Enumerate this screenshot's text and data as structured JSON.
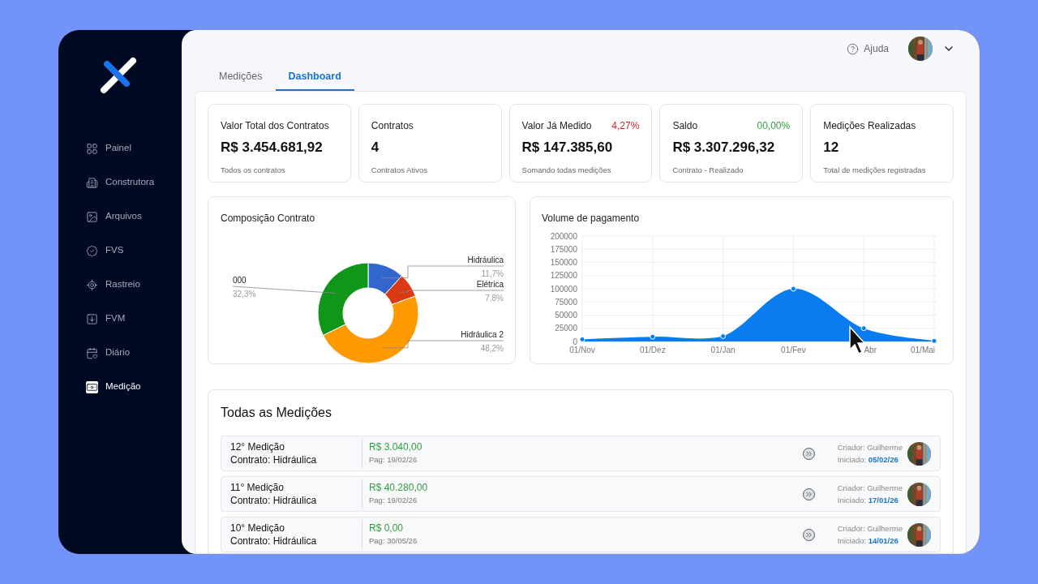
{
  "sidebar": {
    "items": [
      {
        "label": "Painel",
        "selected": false
      },
      {
        "label": "Construtora",
        "selected": false
      },
      {
        "label": "Arquivos",
        "selected": false
      },
      {
        "label": "FVS",
        "selected": false
      },
      {
        "label": "Rastreio",
        "selected": false
      },
      {
        "label": "FVM",
        "selected": false
      },
      {
        "label": "Diário",
        "selected": false
      },
      {
        "label": "Medição",
        "selected": true
      }
    ]
  },
  "header": {
    "help": "Ajuda"
  },
  "tabs": [
    {
      "label": "Medições",
      "selected": false
    },
    {
      "label": "Dashboard",
      "selected": true
    }
  ],
  "stats": [
    {
      "title": "Valor Total dos Contratos",
      "value": "R$ 3.454.681,92",
      "caption": "Todos os contratos"
    },
    {
      "title": "Contratos",
      "value": "4",
      "caption": "Contratos Ativos"
    },
    {
      "title": "Valor Já Medido",
      "badge": "4,27%",
      "color": "#c62828",
      "value": "R$ 147.385,60",
      "caption": "Somando todas medições"
    },
    {
      "title": "Saldo",
      "badge": "00,00%",
      "color": "#2e9e3e",
      "value": "R$ 3.307.296,32",
      "caption": "Contrato - Realizado"
    },
    {
      "title": "Medições Realizadas",
      "value": "12",
      "caption": "Total de medições registradas"
    }
  ],
  "composition": {
    "title": "Composição Contrato",
    "chart_data": {
      "type": "donut",
      "categories": [
        "Hidráulica",
        "Elétrica",
        "Hidráulica 2",
        "000"
      ],
      "values": [
        11.7,
        7.8,
        48.2,
        32.3
      ],
      "colors": [
        "#3366cc",
        "#dc3912",
        "#ff9900",
        "#109618"
      ],
      "value_labels": [
        "11,7%",
        "7,8%",
        "48,2%",
        "32,3%"
      ]
    }
  },
  "payments": {
    "title": "Volume de pagamento",
    "chart_data": {
      "type": "area",
      "categories": [
        "01/Nov",
        "01/Dez",
        "01/Jan",
        "01/Fev",
        "Abr",
        "01/Mai"
      ],
      "grid": true,
      "series": [
        {
          "color": "#0a7cf0",
          "values": [
            4000,
            9000,
            10000,
            100000,
            25000,
            1000
          ]
        }
      ],
      "ylim": [
        0,
        200000
      ],
      "yticks": [
        0,
        25000,
        50000,
        75000,
        100000,
        125000,
        150000,
        175000,
        200000
      ]
    }
  },
  "measurements": {
    "title": "Todas as Medições",
    "rows": [
      {
        "name": "12° Medição",
        "contract": "Contrato: Hidráulica",
        "amount": "R$ 3.040,00",
        "paid": "Pag: 19/02/26",
        "creator": "Criador: Guilherme",
        "started_label": "Iniciado:",
        "started": "05/02/26"
      },
      {
        "name": "11° Medição",
        "contract": "Contrato: Hidráulica",
        "amount": "R$ 40.280,00",
        "paid": "Pag: 19/02/26",
        "creator": "Criador: Guilherme",
        "started_label": "Iniciado:",
        "started": "17/01/26"
      },
      {
        "name": "10° Medição",
        "contract": "Contrato: Hidráulica",
        "amount": "R$ 0,00",
        "paid": "Pag: 30/05/26",
        "creator": "Criador: Guilherme",
        "started_label": "Iniciado:",
        "started": "14/01/26"
      }
    ]
  }
}
